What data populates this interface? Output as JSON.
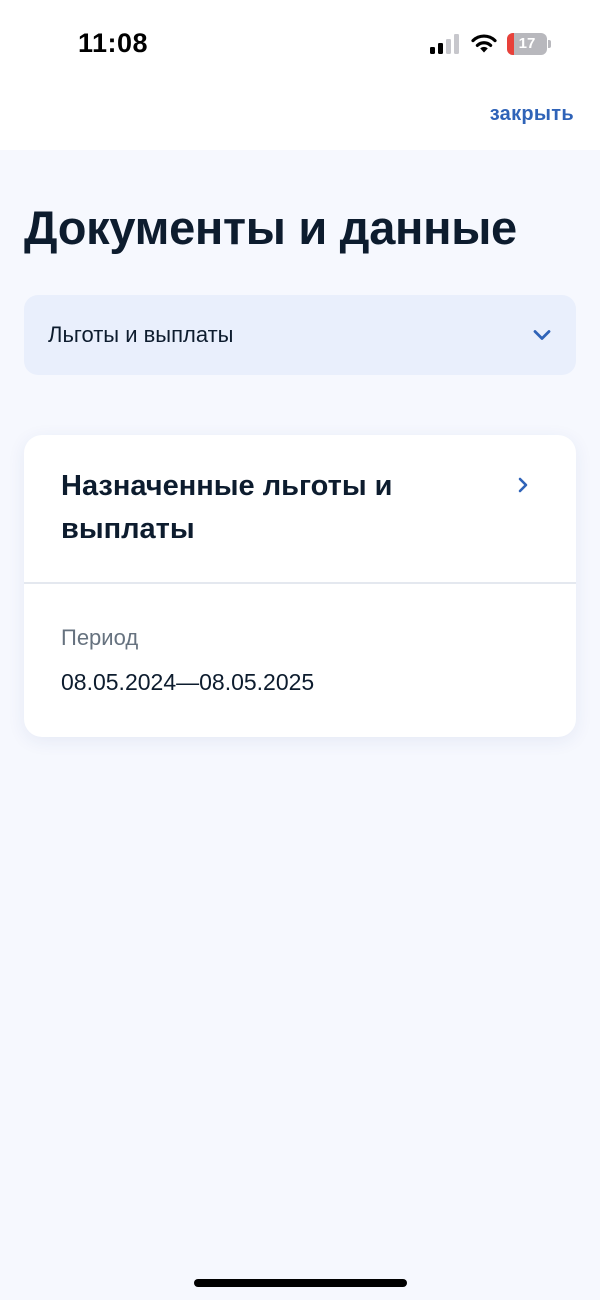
{
  "status_bar": {
    "time": "11:08",
    "battery_percent": "17",
    "battery_level": 0.17,
    "battery_color": "#e8413a",
    "icons": [
      "cellular-signal-icon",
      "wifi-icon",
      "battery-icon"
    ]
  },
  "header": {
    "close_label": "закрыть"
  },
  "page": {
    "title": "Документы и данные"
  },
  "category_select": {
    "selected": "Льготы и выплаты",
    "icon": "chevron-down-icon"
  },
  "card": {
    "title": "Назначенные льготы и выплаты",
    "icon": "chevron-right-icon",
    "period_label": "Период",
    "period_value": "08.05.2024—08.05.2025"
  },
  "colors": {
    "accent": "#2f63b8",
    "text_primary": "#0d1c2e",
    "text_secondary": "#66727f",
    "background": "#f6f8fe",
    "select_background": "#e9effc"
  }
}
